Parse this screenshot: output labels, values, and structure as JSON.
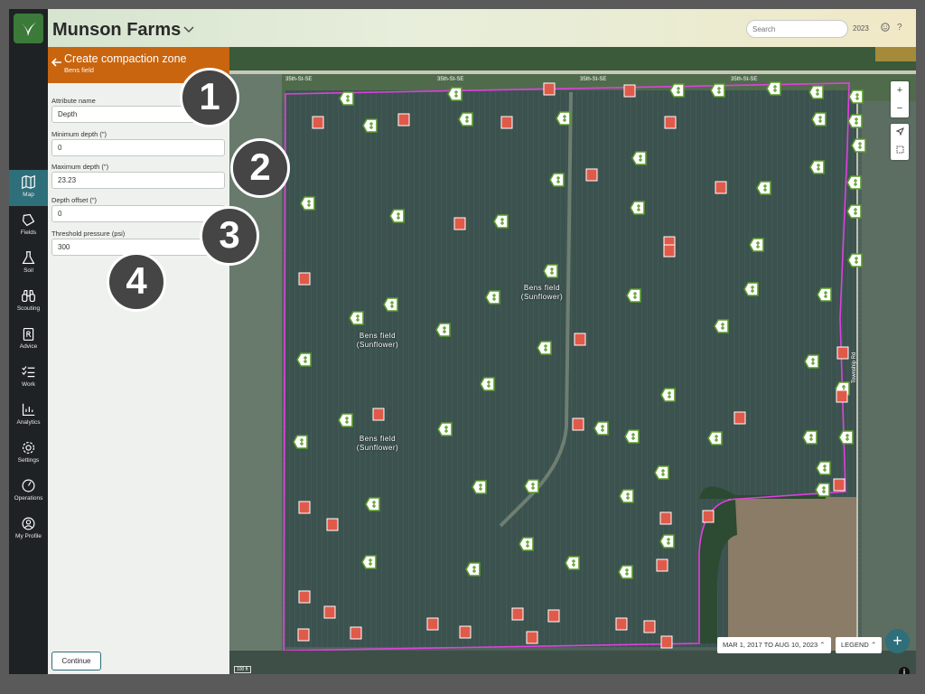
{
  "header": {
    "farm_name": "Munson Farms",
    "search_placeholder": "Search",
    "year": "2023",
    "help": "?"
  },
  "nav": {
    "items": [
      {
        "label": "Map",
        "icon": "map-icon",
        "active": true
      },
      {
        "label": "Fields",
        "icon": "fields-icon"
      },
      {
        "label": "Soil",
        "icon": "flask-icon"
      },
      {
        "label": "Scouting",
        "icon": "binoculars-icon"
      },
      {
        "label": "Advice",
        "icon": "prescription-icon"
      },
      {
        "label": "Work",
        "icon": "checklist-icon"
      },
      {
        "label": "Analytics",
        "icon": "chart-icon"
      },
      {
        "label": "Settings",
        "icon": "gear-icon"
      },
      {
        "label": "Operations",
        "icon": "gauge-icon"
      },
      {
        "label": "My Profile",
        "icon": "user-icon"
      }
    ]
  },
  "panel": {
    "title": "Create compaction zone",
    "subtitle": "Bens field",
    "fields": [
      {
        "label": "Attribute name",
        "value": "Depth"
      },
      {
        "label": "Minimum depth (\")",
        "value": "0"
      },
      {
        "label": "Maximum depth (\")",
        "value": "23.23"
      },
      {
        "label": "Depth offset (\")",
        "value": "0"
      },
      {
        "label": "Threshold pressure (psi)",
        "value": "300"
      }
    ],
    "continue_label": "Continue"
  },
  "callouts": [
    "1",
    "2",
    "3",
    "4"
  ],
  "map": {
    "roads": [
      "35th-St-SE",
      "35th-St-SE",
      "35th-St-SE",
      "35th-St-SE"
    ],
    "vertical_road": "Township Rd",
    "field_labels": [
      {
        "name": "Bens field",
        "crop": "(Sunflower)"
      },
      {
        "name": "Bens field",
        "crop": "(Sunflower)"
      },
      {
        "name": "Bens field",
        "crop": "(Sunflower)"
      }
    ],
    "zoom_in": "+",
    "zoom_out": "−",
    "date_range": "MAR 1, 2017 TO AUG 10, 2023",
    "legend_label": "LEGEND",
    "scale": "100 ft",
    "fab_label": "+",
    "info_label": "i",
    "colors": {
      "boundary": "#e040e0",
      "sample_green": "#5a9a2a",
      "sample_red": "#e05a4a",
      "accent": "#2e6f7a",
      "panel_header": "#c9650f"
    }
  }
}
